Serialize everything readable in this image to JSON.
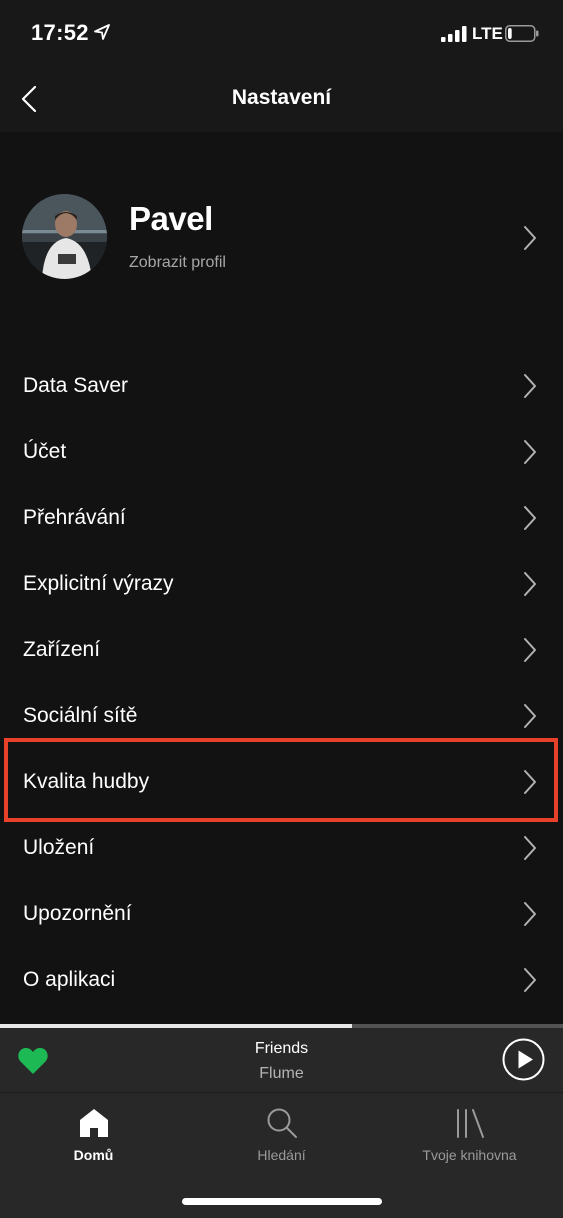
{
  "status_bar": {
    "time": "17:52",
    "network": "LTE",
    "battery_level": 0.15
  },
  "nav": {
    "title": "Nastavení",
    "back_icon": "chevron-left-icon"
  },
  "profile": {
    "name": "Pavel",
    "subtitle": "Zobrazit profil"
  },
  "settings": {
    "items": [
      {
        "label": "Data Saver"
      },
      {
        "label": "Účet"
      },
      {
        "label": "Přehrávání"
      },
      {
        "label": "Explicitní výrazy"
      },
      {
        "label": "Zařízení"
      },
      {
        "label": "Sociální sítě"
      },
      {
        "label": "Kvalita hudby",
        "highlighted": true
      },
      {
        "label": "Uložení"
      },
      {
        "label": "Upozornění"
      },
      {
        "label": "O aplikaci"
      }
    ]
  },
  "now_playing": {
    "title": "Friends",
    "artist": "Flume",
    "progress": 0.625,
    "liked": true
  },
  "tabs": [
    {
      "label": "Domů",
      "icon": "home-icon",
      "active": true
    },
    {
      "label": "Hledání",
      "icon": "search-icon",
      "active": false
    },
    {
      "label": "Tvoje knihovna",
      "icon": "library-icon",
      "active": false
    }
  ],
  "colors": {
    "background": "#121212",
    "header": "#181818",
    "player": "#282828",
    "accent_green": "#1db954",
    "highlight_red": "#e8432a"
  }
}
